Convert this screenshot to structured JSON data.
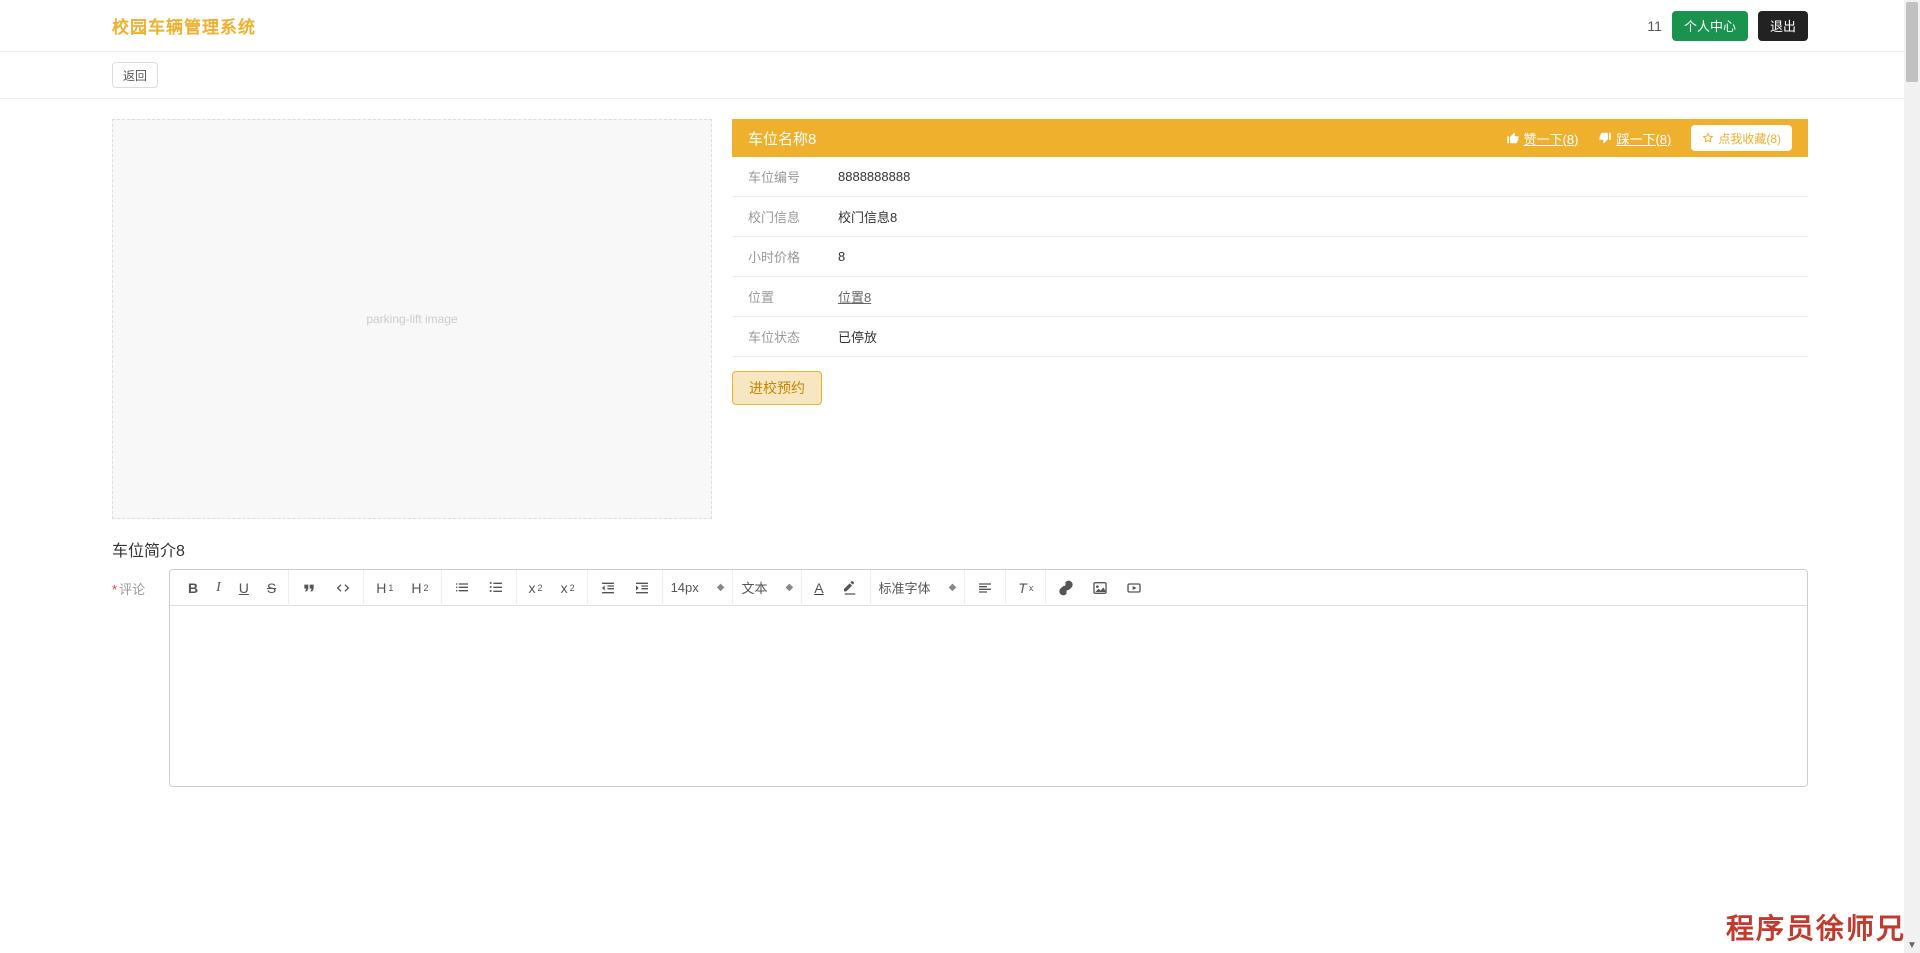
{
  "header": {
    "brand": "校园车辆管理系统",
    "user_number": "11",
    "profile_label": "个人中心",
    "logout_label": "退出"
  },
  "backrow": {
    "back_label": "返回"
  },
  "title": {
    "name": "车位名称8",
    "like_label": "赞一下(8)",
    "dislike_label": "踩一下(8)",
    "fav_label": "点我收藏(8)"
  },
  "info": {
    "rows": [
      {
        "label": "车位编号",
        "value": "8888888888",
        "link": false
      },
      {
        "label": "校门信息",
        "value": "校门信息8",
        "link": false
      },
      {
        "label": "小时价格",
        "value": "8",
        "link": false
      },
      {
        "label": "位置",
        "value": "位置8",
        "link": true
      },
      {
        "label": "车位状态",
        "value": "已停放",
        "link": false
      }
    ],
    "action_label": "进校预约"
  },
  "subtitle": "车位简介8",
  "editor": {
    "label": "评论",
    "font_size": "14px",
    "para_label": "文本",
    "font_family": "标准字体"
  },
  "watermark": "程序员徐师兄",
  "img_placeholder": "parking-lift image"
}
